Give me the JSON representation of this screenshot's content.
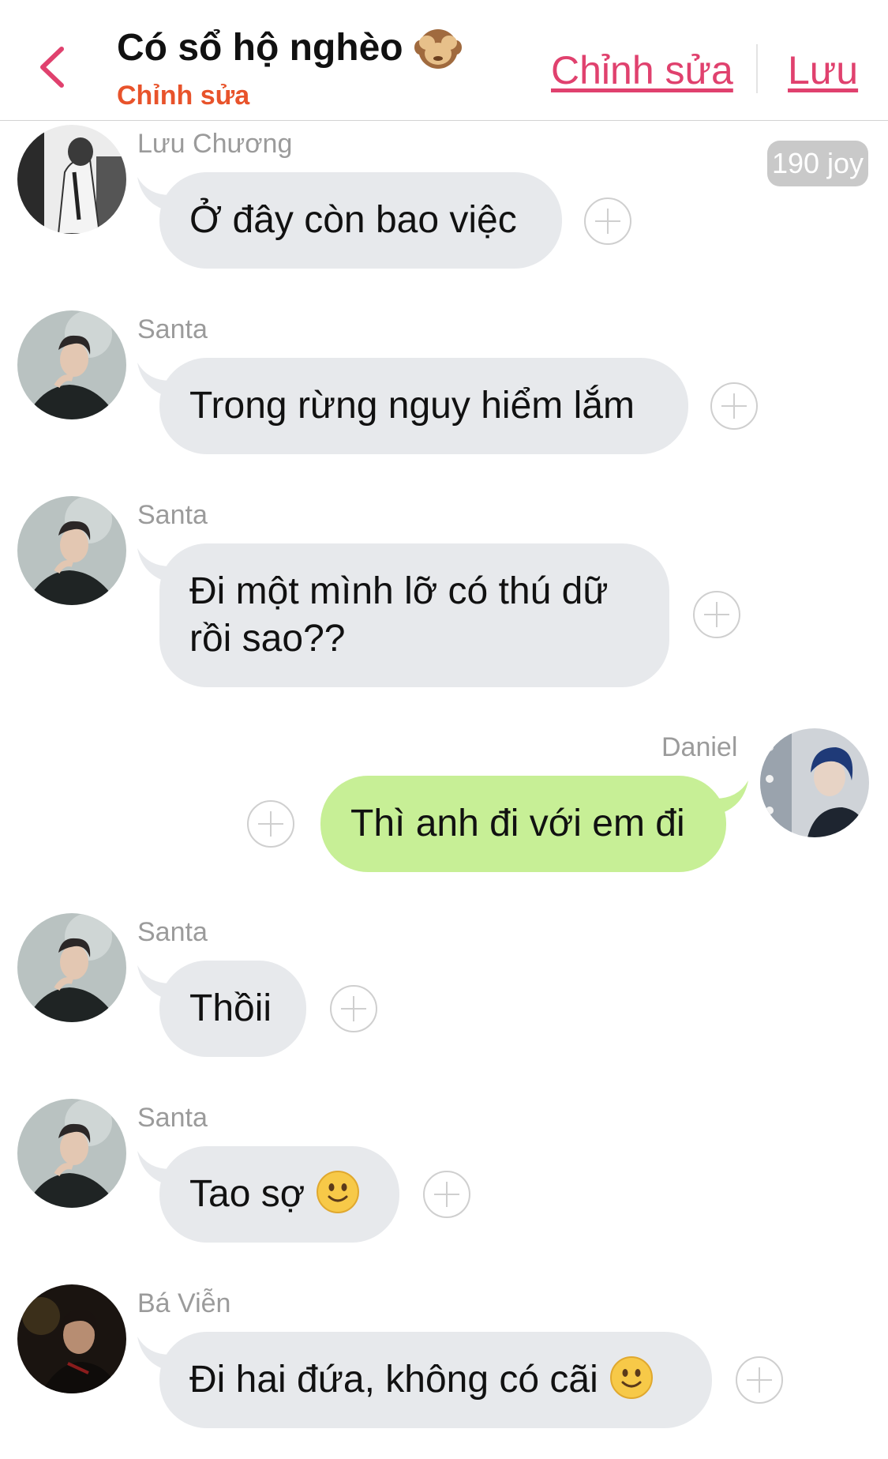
{
  "header": {
    "title": "Có sổ hộ nghèo",
    "title_emoji": "see-no-evil-monkey",
    "subtitle": "Chỉnh sửa",
    "edit_label": "Chỉnh sửa",
    "save_label": "Lưu"
  },
  "badge": {
    "joy": "190 joy"
  },
  "messages": [
    {
      "sender": "Lưu Chương",
      "text": "Ở đây còn bao việc",
      "side": "left"
    },
    {
      "sender": "Santa",
      "text": "Trong rừng nguy hiểm lắm",
      "side": "left"
    },
    {
      "sender": "Santa",
      "text_line1": "Đi một mình lỡ có thú dữ",
      "text_line2": "rồi sao??",
      "side": "left"
    },
    {
      "sender": "Daniel",
      "text": "Thì anh đi với em đi",
      "side": "right"
    },
    {
      "sender": "Santa",
      "text": "Thồii",
      "side": "left"
    },
    {
      "sender": "Santa",
      "text": "Tao sợ",
      "emoji": "slightly-smiling-face",
      "side": "left"
    },
    {
      "sender": "Bá Viễn",
      "text": "Đi hai đứa, không có cãi",
      "emoji": "slightly-smiling-face",
      "side": "left"
    }
  ],
  "colors": {
    "accent": "#e0416e",
    "subtitle": "#e8532b",
    "bubble_in": "#e7e9ec",
    "bubble_out": "#c7ef96",
    "sender": "#9b9b9b"
  }
}
